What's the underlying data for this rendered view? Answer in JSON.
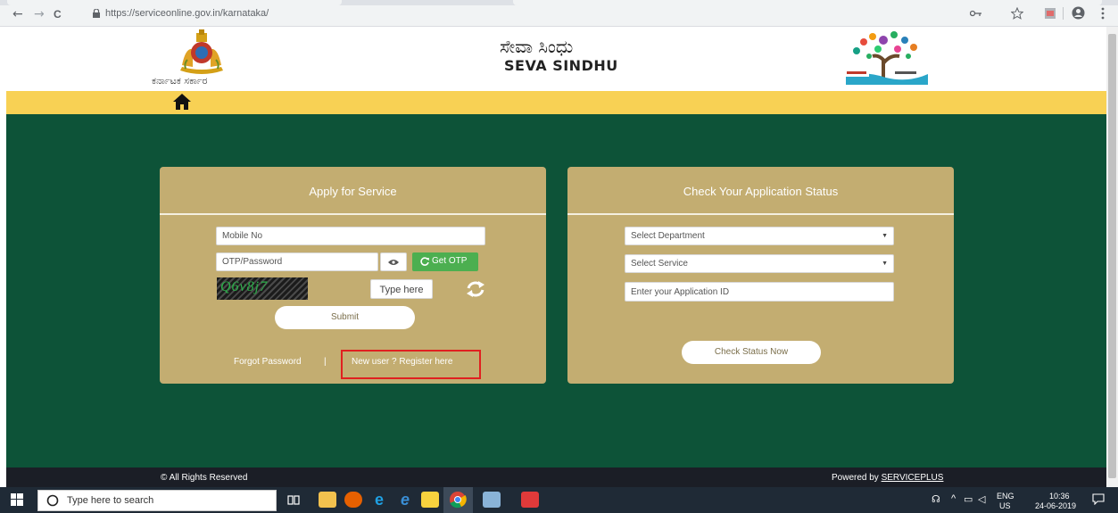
{
  "browser": {
    "url": "https://serviceonline.gov.in/karnataka/",
    "back": "←",
    "forward": "→",
    "reload": "C",
    "icons": [
      "key-icon",
      "star-icon",
      "extension-icon",
      "profile-icon",
      "menu-icon"
    ]
  },
  "header": {
    "state_name": "ಕರ್ನಾಟಕ ಸರ್ಕಾರ",
    "brand_kannada": "ಸೇವಾ ಸಿಂಧು",
    "brand_english": "SEVA SINDHU"
  },
  "apply_panel": {
    "title": "Apply for Service",
    "mobile_placeholder": "Mobile No",
    "otp_placeholder": "OTP/Password",
    "get_otp_label": "Get OTP",
    "captcha_text": "Q6v8j7",
    "captcha_input_placeholder": "Type here",
    "submit_label": "Submit",
    "forgot_password": "Forgot Password",
    "separator": "|",
    "register_link": "New user ? Register here"
  },
  "status_panel": {
    "title": "Check Your Application Status",
    "department_select": "Select Department",
    "service_select": "Select Service",
    "application_id_placeholder": "Enter your Application ID",
    "check_button": "Check Status Now"
  },
  "footer": {
    "rights": "© All Rights Reserved",
    "powered_by": "Powered by",
    "powered_link": "SERVICEPLUS"
  },
  "taskbar": {
    "search_placeholder": "Type here to search",
    "lang": "ENG",
    "region": "US",
    "time": "10:36",
    "date": "24-06-2019"
  },
  "colors": {
    "green": "#0d5338",
    "yellow": "#f8d154",
    "panel": "#c3ad71",
    "otp_button": "#4caf50",
    "highlight": "#e02020"
  }
}
